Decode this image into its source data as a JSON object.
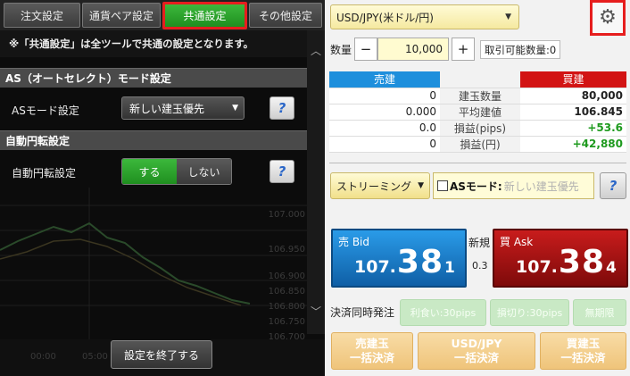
{
  "tabs": [
    "注文設定",
    "通貨ペア設定",
    "共通設定",
    "その他設定"
  ],
  "notice": "※「共通設定」は全ツールで共通の設定となります。",
  "as_section": {
    "heading": "AS（オートセレクト）モード設定",
    "label": "ASモード設定",
    "value": "新しい建玉優先",
    "help": "?"
  },
  "auto_section": {
    "heading": "自動円転設定",
    "label": "自動円転設定",
    "on": "する",
    "off": "しない",
    "help": "?"
  },
  "background_chart": {
    "prices": [
      "107.000",
      "106.950",
      "106.900",
      "106.850",
      "106.800",
      "106.750",
      "106.700"
    ],
    "times": [
      "00:00",
      "05:00"
    ]
  },
  "end_button": "設定を終了する",
  "pair": "USD/JPY(米ドル/円)",
  "quantity": {
    "label": "数量",
    "minus": "−",
    "plus": "+",
    "value": "10,000",
    "available": "取引可能数量:0"
  },
  "positions": {
    "sell_header": "売建",
    "buy_header": "買建",
    "rows": [
      {
        "sell": "0",
        "label": "建玉数量",
        "buy": "80,000"
      },
      {
        "sell": "0.000",
        "label": "平均建値",
        "buy": "106.845"
      },
      {
        "sell": "0.0",
        "label": "損益(pips)",
        "buy": "+53.6"
      },
      {
        "sell": "0",
        "label": "損益(円)",
        "buy": "+42,880"
      }
    ]
  },
  "streaming": "ストリーミング",
  "as_mode": {
    "label": "ASモード:",
    "value": "新しい建玉優先"
  },
  "help": "?",
  "bid": {
    "label": "売 Bid",
    "small": "107.",
    "big": "38",
    "tail": "1"
  },
  "ask": {
    "label": "買 Ask",
    "small": "107.",
    "big": "38",
    "tail": "4"
  },
  "new_label": "新規",
  "spread": "0.3",
  "simultaneous": {
    "label": "決済同時発注",
    "take_profit": "利食い:30pips",
    "stop_loss": "損切り:30pips",
    "unlimited": "無期限"
  },
  "bulk": {
    "sell_line1": "売建玉",
    "sell_line2": "一括決済",
    "pair_line1": "USD/JPY",
    "pair_line2": "一括決済",
    "buy_line1": "買建玉",
    "buy_line2": "一括決済"
  },
  "colors": {
    "accent_green": "#2aa52a",
    "sell_blue": "#1e8fdc",
    "buy_red": "#d21414",
    "highlight": "#e61e1e"
  },
  "icons": {
    "settings": "gear-icon",
    "help": "help-icon",
    "scroll_up": "chevron-up-icon",
    "scroll_down": "chevron-down-icon"
  }
}
